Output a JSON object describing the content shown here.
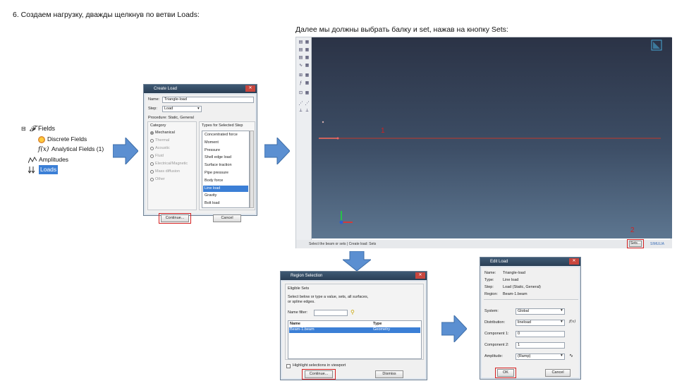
{
  "captions": {
    "step6": "6. Создаем нагрузку, дважды щелкнув по ветви Loads:",
    "next": "Далее мы должны выбрать балку и set, нажав на кнопку Sets:"
  },
  "tree": {
    "items": [
      {
        "label": "Fields",
        "icon": "script-f-icon"
      },
      {
        "label": "Discrete Fields",
        "icon": "discrete-fields-icon"
      },
      {
        "label": "Analytical Fields (1)",
        "icon": "function-icon"
      },
      {
        "label": "Amplitudes",
        "icon": "amplitude-icon"
      },
      {
        "label": "Loads",
        "icon": "loads-icon"
      }
    ]
  },
  "create_load": {
    "title": "Create Load",
    "name_label": "Name:",
    "name_value": "Triangle-load",
    "step_label": "Step:",
    "step_value": "Load",
    "procedure": "Procedure: Static, General",
    "category_header": "Category",
    "categories": [
      {
        "label": "Mechanical",
        "selected": true
      },
      {
        "label": "Thermal",
        "selected": false
      },
      {
        "label": "Acoustic",
        "selected": false
      },
      {
        "label": "Fluid",
        "selected": false
      },
      {
        "label": "Electrical/Magnetic",
        "selected": false
      },
      {
        "label": "Mass diffusion",
        "selected": false
      },
      {
        "label": "Other",
        "selected": false
      }
    ],
    "types_header": "Types for Selected Step",
    "types": [
      "Concentrated force",
      "Moment",
      "Pressure",
      "Shell edge load",
      "Surface traction",
      "Pipe pressure",
      "Body force",
      "Line load",
      "Gravity",
      "Bolt load"
    ],
    "selected_type": "Line load",
    "continue_label": "Continue...",
    "cancel_label": "Cancel"
  },
  "viewport": {
    "labels": {
      "one": "1",
      "two": "2"
    },
    "bottom_text": "Select the beam or sets  |  Create load: Sets",
    "sets_label": "Sets...",
    "brand": "SIMULIA",
    "colors": {
      "beam": "#c0392b",
      "red": "#d42020"
    }
  },
  "region_selection": {
    "title": "Region Selection",
    "eligible_sets": "Eligible Sets",
    "instruction": "Select below or type a value, sets, all surfaces, or spline edges.",
    "name_filter_label": "Name filter:",
    "col_name": "Name",
    "col_type": "Type",
    "rows": [
      {
        "name": "Beam-1.beam",
        "type": "Geometry"
      }
    ],
    "highlight_label": "Highlight selections in viewport",
    "continue_label": "Continue...",
    "dismiss_label": "Dismiss"
  },
  "edit_load": {
    "title": "Edit Load",
    "name_label": "Name:",
    "name_value": "Triangle-load",
    "type_label": "Type:",
    "type_value": "Line load",
    "step_label": "Step:",
    "step_value": "Load (Static, General)",
    "region_label": "Region:",
    "region_value": "Beam-1.beam",
    "system_label": "System:",
    "system_value": "Global",
    "distribution_label": "Distribution:",
    "distribution_value": "lineload",
    "fx_label": "f(x)",
    "comp1_label": "Component 1:",
    "comp1_value": "0",
    "comp2_label": "Component 2:",
    "comp2_value": "1",
    "amplitude_label": "Amplitude:",
    "amplitude_value": "(Ramp)",
    "ok_label": "OK",
    "cancel_label": "Cancel"
  }
}
